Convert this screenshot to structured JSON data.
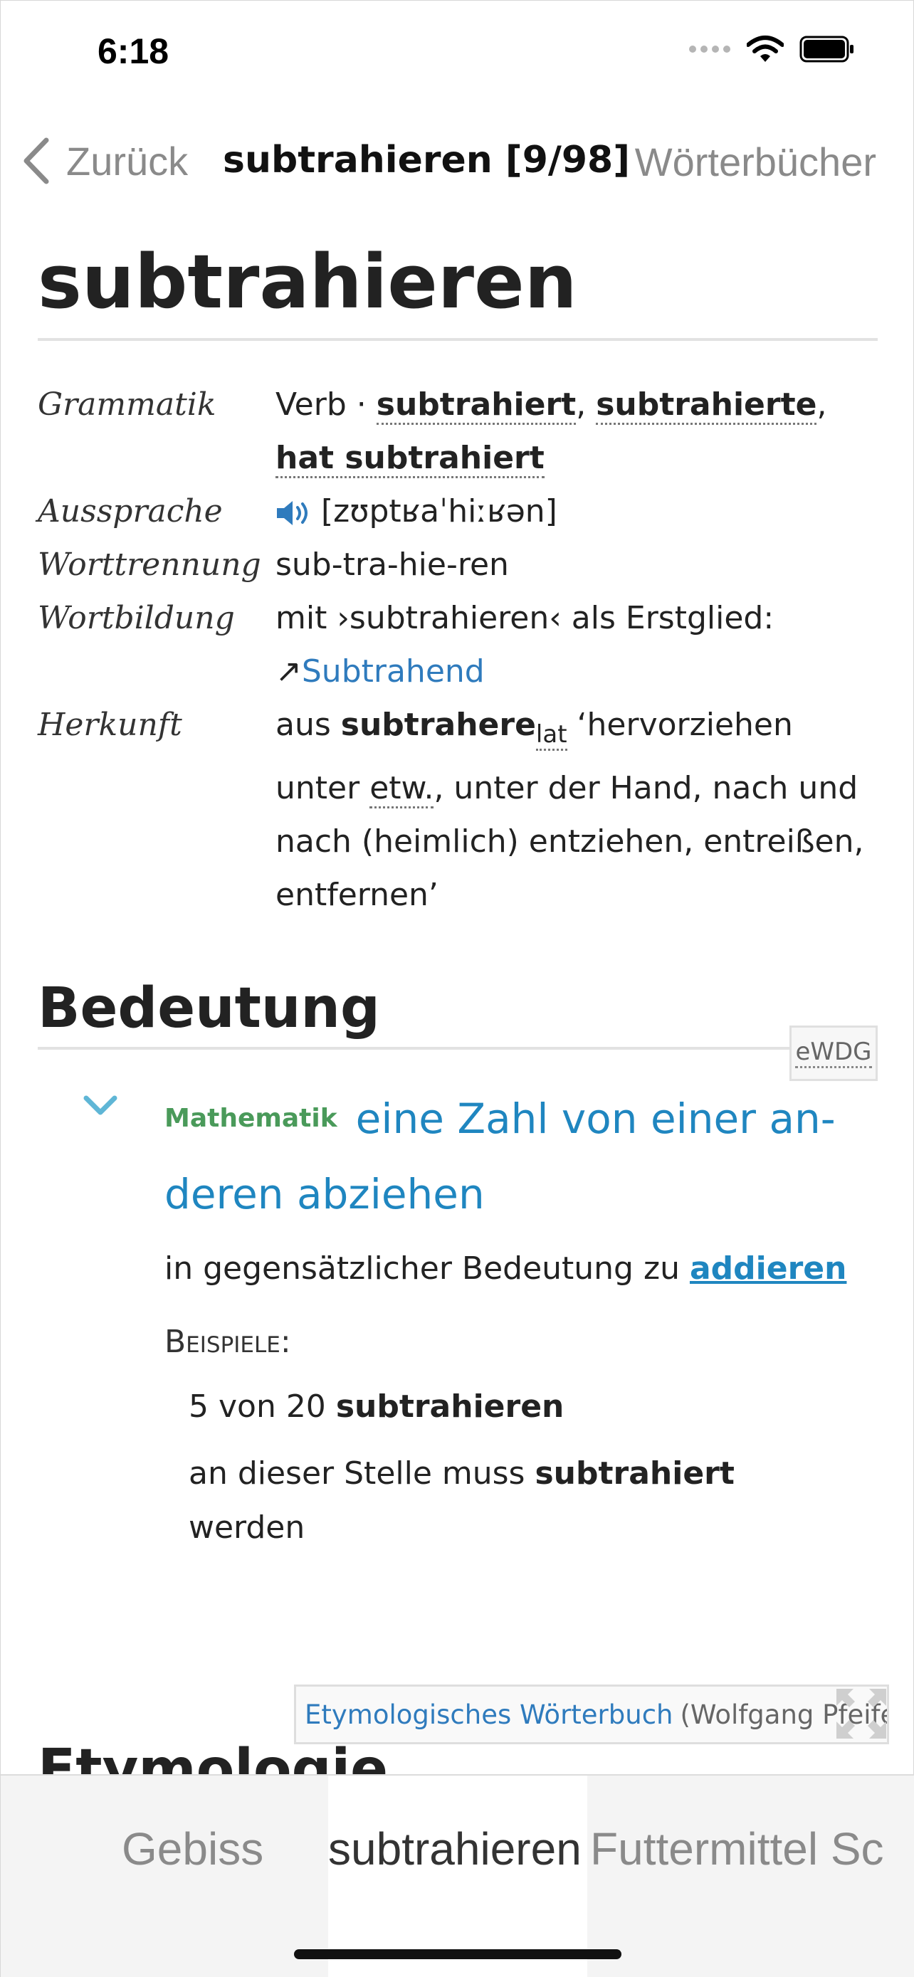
{
  "status": {
    "time": "6:18",
    "icons": [
      "signal-dots-icon",
      "wifi-icon",
      "battery-icon"
    ]
  },
  "nav": {
    "back_label": "Zurück",
    "title": "subtrahieren [9/98]",
    "right_label": "Wörterbücher"
  },
  "entry": {
    "headword": "subtrahieren",
    "grammar": {
      "key": "Grammatik",
      "pos": "Verb",
      "sep": "·",
      "forms": [
        "subtrahiert",
        "subtrahierte",
        "hat subtrahiert"
      ]
    },
    "pronunciation": {
      "key": "Aussprache",
      "ipa": "[zʊptʁaˈhiːʁən]"
    },
    "hyphenation": {
      "key": "Worttrennung",
      "value": "sub-tra-hie-ren"
    },
    "formation": {
      "key": "Wortbildung",
      "text": "mit ›subtrahieren‹ als Erstglied:",
      "arrow": "↗",
      "link": "Subtrahend"
    },
    "origin": {
      "key": "Herkunft",
      "pre": "aus",
      "word": "subtrahere",
      "lang": "lat",
      "gloss_1": "‘hervorziehen unter",
      "abbr": "etw.",
      "gloss_2": ", unter der Hand, nach und nach (heimlich) entziehen, entreißen, entfernen’"
    }
  },
  "meaning": {
    "title": "Bedeutung",
    "badge": "eWDG",
    "category": "Mathematik",
    "definition": "eine Zahl von einer an­deren abziehen",
    "note_pre": "in gegensätzlicher Bedeutung zu",
    "note_link": "addieren",
    "examples_label": "Beispiele:",
    "examples": [
      {
        "pre": "5 von 20",
        "bold": "subtrahieren",
        "post": ""
      },
      {
        "pre": "an dieser Stelle muss",
        "bold": "subtrahiert",
        "post": "werden"
      }
    ]
  },
  "etymology": {
    "source": "Etymologisches Wörterbuch",
    "author": "(Wolfgang Pfeifer)",
    "section_title": "Etymologie"
  },
  "tabs": [
    {
      "label": "Gebiss",
      "active": false
    },
    {
      "label": "subtrahieren",
      "active": true
    },
    {
      "label": "Futtermittel Sc",
      "active": false
    }
  ],
  "colors": {
    "link": "#2f7bbd",
    "definition": "#1f86c0",
    "category": "#4a9a5a"
  }
}
